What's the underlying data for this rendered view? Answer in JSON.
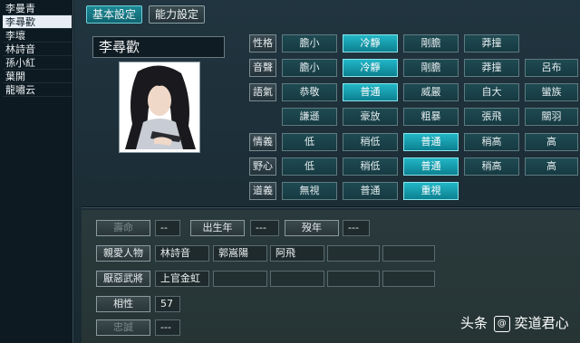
{
  "character_list": [
    "李曼青",
    "李尋歡",
    "李壞",
    "林詩音",
    "孫小紅",
    "葉開",
    "龍嘯云"
  ],
  "selected_index": 1,
  "tabs": {
    "basic": "基本設定",
    "ability": "能力設定"
  },
  "character_name": "李尋歡",
  "attributes": [
    {
      "label": "性格",
      "options": [
        "膽小",
        "冷靜",
        "剛膽",
        "莽撞"
      ],
      "selected": 1
    },
    {
      "label": "音聲",
      "options": [
        "膽小",
        "冷靜",
        "剛膽",
        "莽撞",
        "呂布"
      ],
      "selected": 1
    },
    {
      "label": "語氣",
      "options": [
        "恭敬",
        "普通",
        "威嚴",
        "自大",
        "蠻族"
      ],
      "selected": 1
    },
    {
      "label": "",
      "options": [
        "謙遜",
        "豪放",
        "粗暴",
        "張飛",
        "關羽"
      ],
      "selected": -1
    },
    {
      "label": "情義",
      "options": [
        "低",
        "稍低",
        "普通",
        "稍高",
        "高"
      ],
      "selected": 2
    },
    {
      "label": "野心",
      "options": [
        "低",
        "稍低",
        "普通",
        "稍高",
        "高"
      ],
      "selected": 2
    },
    {
      "label": "道義",
      "options": [
        "無視",
        "普通",
        "重視"
      ],
      "selected": 2
    }
  ],
  "info": {
    "lifespan_label": "壽命",
    "lifespan_value": "--",
    "birth_label": "出生年",
    "birth_value": "---",
    "death_label": "歿年",
    "death_value": "---",
    "beloved_label": "親愛人物",
    "beloved": [
      "林詩音",
      "郭嵩陽",
      "阿飛"
    ],
    "hated_label": "厭惡武將",
    "hated": [
      "上官金虹"
    ],
    "affinity_label": "相性",
    "affinity_value": "57",
    "loyalty_label": "忠誠",
    "loyalty_value": "---"
  },
  "watermark": {
    "prefix": "头条",
    "at": "@",
    "author": "奕道君心"
  }
}
